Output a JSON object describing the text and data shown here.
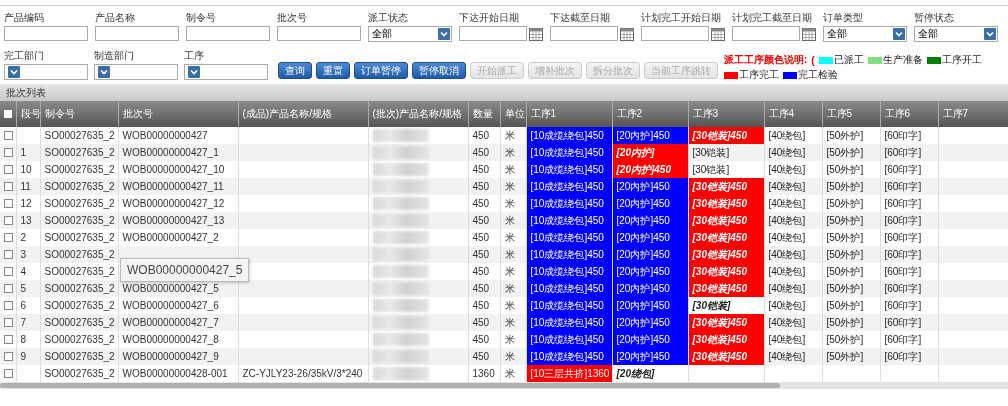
{
  "filters": [
    {
      "label": "产品编码",
      "kind": "text"
    },
    {
      "label": "产品名称",
      "kind": "text"
    },
    {
      "label": "制令号",
      "kind": "text"
    },
    {
      "label": "批次号",
      "kind": "text"
    },
    {
      "label": "派工状态",
      "kind": "select",
      "value": "全部"
    },
    {
      "label": "下达开始日期",
      "kind": "date"
    },
    {
      "label": "下达截至日期",
      "kind": "date"
    },
    {
      "label": "计划完工开始日期",
      "kind": "date"
    },
    {
      "label": "计划完工截至日期",
      "kind": "date"
    },
    {
      "label": "订单类型",
      "kind": "select",
      "value": "全部"
    },
    {
      "label": "暂停状态",
      "kind": "select",
      "value": "全部"
    }
  ],
  "filters2": [
    {
      "label": "完工部门",
      "kind": "select"
    },
    {
      "label": "制造部门",
      "kind": "select"
    },
    {
      "label": "工序",
      "kind": "select"
    }
  ],
  "buttons": [
    {
      "label": "查询",
      "disabled": false
    },
    {
      "label": "重置",
      "disabled": false
    },
    {
      "label": "订单暂停",
      "disabled": false
    },
    {
      "label": "暂停取消",
      "disabled": false
    },
    {
      "label": "开始派工",
      "disabled": true
    },
    {
      "label": "增补批次",
      "disabled": true
    },
    {
      "label": "拆分批次",
      "disabled": true
    },
    {
      "label": "当前工序跳转",
      "disabled": true
    }
  ],
  "legend": {
    "title": "派工工序颜色说明:",
    "open": "(",
    "items": [
      {
        "label": "已派工",
        "color": "#00ffff"
      },
      {
        "label": "生产准备",
        "color": "#80e080"
      },
      {
        "label": "工序开工",
        "color": "#008000"
      },
      {
        "label": "工序完工",
        "color": "#ff0000"
      },
      {
        "label": "完工检验",
        "color": "#0000ff"
      }
    ]
  },
  "panel_title": "批次列表",
  "table": {
    "select_all_checked": false,
    "columns": [
      "段号",
      "制令号",
      "批次号",
      "(成品)产品名称/规格",
      "(批次)产品名称/规格",
      "数量",
      "单位",
      "工序1",
      "工序2",
      "工序3",
      "工序4",
      "工序5",
      "工序6",
      "工序7"
    ],
    "rows": [
      {
        "checked": false,
        "seq": "",
        "order": "SO00027635_2",
        "batch": "WOB00000000427",
        "qty": "450",
        "unit": "米",
        "procs": [
          {
            "text": "[10成缆绕包]450",
            "color": "#0000ff",
            "in_progress": false
          },
          {
            "text": "[20内护]450",
            "color": "#0000ff",
            "in_progress": false
          },
          {
            "text": "[30铠装]450",
            "color": "#ff0000",
            "in_progress": true
          },
          {
            "text": "[40绕包]",
            "in_progress": false
          },
          {
            "text": "[50外护]",
            "in_progress": false
          },
          {
            "text": "[60印字]",
            "in_progress": false
          }
        ]
      },
      {
        "checked": false,
        "seq": "1",
        "order": "SO00027635_2",
        "batch": "WOB00000000427_1",
        "qty": "450",
        "unit": "米",
        "procs": [
          {
            "text": "[10成缆绕包]450",
            "color": "#0000ff",
            "in_progress": false
          },
          {
            "text": "[20内护]",
            "color": "#ff0000",
            "in_progress": true
          },
          {
            "text": "[30铠装]",
            "in_progress": false
          },
          {
            "text": "[40绕包]",
            "in_progress": false
          },
          {
            "text": "[50外护]",
            "in_progress": false
          },
          {
            "text": "[60印字]",
            "in_progress": false
          }
        ]
      },
      {
        "checked": false,
        "seq": "10",
        "order": "SO00027635_2",
        "batch": "WOB00000000427_10",
        "qty": "450",
        "unit": "米",
        "procs": [
          {
            "text": "[10成缆绕包]450",
            "color": "#0000ff",
            "in_progress": false
          },
          {
            "text": "[20内护]450",
            "color": "#ff0000",
            "in_progress": true
          },
          {
            "text": "[30铠装]",
            "in_progress": false
          },
          {
            "text": "[40绕包]",
            "in_progress": false
          },
          {
            "text": "[50外护]",
            "in_progress": false
          },
          {
            "text": "[60印字]",
            "in_progress": false
          }
        ]
      },
      {
        "checked": false,
        "seq": "11",
        "order": "SO00027635_2",
        "batch": "WOB00000000427_11",
        "qty": "450",
        "unit": "米",
        "procs": [
          {
            "text": "[10成缆绕包]450",
            "color": "#0000ff",
            "in_progress": false
          },
          {
            "text": "[20内护]450",
            "color": "#0000ff",
            "in_progress": false
          },
          {
            "text": "[30铠装]450",
            "color": "#ff0000",
            "in_progress": true
          },
          {
            "text": "[40绕包]",
            "in_progress": false
          },
          {
            "text": "[50外护]",
            "in_progress": false
          },
          {
            "text": "[60印字]",
            "in_progress": false
          }
        ]
      },
      {
        "checked": false,
        "seq": "12",
        "order": "SO00027635_2",
        "batch": "WOB00000000427_12",
        "qty": "450",
        "unit": "米",
        "procs": [
          {
            "text": "[10成缆绕包]450",
            "color": "#0000ff",
            "in_progress": false
          },
          {
            "text": "[20内护]450",
            "color": "#0000ff",
            "in_progress": false
          },
          {
            "text": "[30铠装]450",
            "color": "#ff0000",
            "in_progress": true
          },
          {
            "text": "[40绕包]",
            "in_progress": false
          },
          {
            "text": "[50外护]",
            "in_progress": false
          },
          {
            "text": "[60印字]",
            "in_progress": false
          }
        ]
      },
      {
        "checked": false,
        "seq": "13",
        "order": "SO00027635_2",
        "batch": "WOB00000000427_13",
        "qty": "450",
        "unit": "米",
        "procs": [
          {
            "text": "[10成缆绕包]450",
            "color": "#0000ff",
            "in_progress": false
          },
          {
            "text": "[20内护]450",
            "color": "#0000ff",
            "in_progress": false
          },
          {
            "text": "[30铠装]450",
            "color": "#ff0000",
            "in_progress": true
          },
          {
            "text": "[40绕包]",
            "in_progress": false
          },
          {
            "text": "[50外护]",
            "in_progress": false
          },
          {
            "text": "[60印字]",
            "in_progress": false
          }
        ]
      },
      {
        "checked": false,
        "seq": "2",
        "order": "SO00027635_2",
        "batch": "WOB00000000427_2",
        "qty": "450",
        "unit": "米",
        "procs": [
          {
            "text": "[10成缆绕包]450",
            "color": "#0000ff",
            "in_progress": false
          },
          {
            "text": "[20内护]450",
            "color": "#0000ff",
            "in_progress": false
          },
          {
            "text": "[30铠装]450",
            "color": "#ff0000",
            "in_progress": true
          },
          {
            "text": "[40绕包]",
            "in_progress": false
          },
          {
            "text": "[50外护]",
            "in_progress": false
          },
          {
            "text": "[60印字]",
            "in_progress": false
          }
        ]
      },
      {
        "checked": false,
        "seq": "3",
        "order": "SO00027635_2",
        "qty": "450",
        "unit": "米",
        "procs": [
          {
            "text": "[10成缆绕包]450",
            "color": "#0000ff",
            "in_progress": false
          },
          {
            "text": "[20内护]450",
            "color": "#0000ff",
            "in_progress": false
          },
          {
            "text": "[30铠装]450",
            "color": "#ff0000",
            "in_progress": true
          },
          {
            "text": "[40绕包]",
            "in_progress": false
          },
          {
            "text": "[50外护]",
            "in_progress": false
          },
          {
            "text": "[60印字]",
            "in_progress": false
          }
        ]
      },
      {
        "checked": false,
        "seq": "4",
        "order": "SO00027635_2",
        "qty": "450",
        "unit": "米",
        "procs": [
          {
            "text": "[10成缆绕包]450",
            "color": "#0000ff",
            "in_progress": false
          },
          {
            "text": "[20内护]450",
            "color": "#0000ff",
            "in_progress": false
          },
          {
            "text": "[30铠装]450",
            "color": "#ff0000",
            "in_progress": true
          },
          {
            "text": "[40绕包]",
            "in_progress": false
          },
          {
            "text": "[50外护]",
            "in_progress": false
          },
          {
            "text": "[60印字]",
            "in_progress": false
          }
        ]
      },
      {
        "checked": false,
        "seq": "5",
        "order": "SO00027635_2",
        "batch": "WOB00000000427_5",
        "qty": "450",
        "unit": "米",
        "procs": [
          {
            "text": "[10成缆绕包]450",
            "color": "#0000ff",
            "in_progress": false
          },
          {
            "text": "[20内护]450",
            "color": "#0000ff",
            "in_progress": false
          },
          {
            "text": "[30铠装]450",
            "color": "#ff0000",
            "in_progress": true
          },
          {
            "text": "[40绕包]",
            "in_progress": false
          },
          {
            "text": "[50外护]",
            "in_progress": false
          },
          {
            "text": "[60印字]",
            "in_progress": false
          }
        ]
      },
      {
        "checked": false,
        "seq": "6",
        "order": "SO00027635_2",
        "batch": "WOB00000000427_6",
        "qty": "450",
        "unit": "米",
        "procs": [
          {
            "text": "[10成缆绕包]450",
            "color": "#0000ff",
            "in_progress": false
          },
          {
            "text": "[20内护]450",
            "color": "#0000ff",
            "in_progress": false
          },
          {
            "text": "[30铠装]",
            "in_progress": true
          },
          {
            "text": "[40绕包]",
            "in_progress": false
          },
          {
            "text": "[50外护]",
            "in_progress": false
          },
          {
            "text": "[60印字]",
            "in_progress": false
          }
        ]
      },
      {
        "checked": false,
        "seq": "7",
        "order": "SO00027635_2",
        "batch": "WOB00000000427_7",
        "qty": "450",
        "unit": "米",
        "procs": [
          {
            "text": "[10成缆绕包]450",
            "color": "#0000ff",
            "in_progress": false
          },
          {
            "text": "[20内护]450",
            "color": "#0000ff",
            "in_progress": false
          },
          {
            "text": "[30铠装]450",
            "color": "#ff0000",
            "in_progress": true
          },
          {
            "text": "[40绕包]",
            "in_progress": false
          },
          {
            "text": "[50外护]",
            "in_progress": false
          },
          {
            "text": "[60印字]",
            "in_progress": false
          }
        ]
      },
      {
        "checked": false,
        "seq": "8",
        "order": "SO00027635_2",
        "batch": "WOB00000000427_8",
        "qty": "450",
        "unit": "米",
        "procs": [
          {
            "text": "[10成缆绕包]450",
            "color": "#0000ff",
            "in_progress": false
          },
          {
            "text": "[20内护]450",
            "color": "#0000ff",
            "in_progress": false
          },
          {
            "text": "[30铠装]450",
            "color": "#ff0000",
            "in_progress": true
          },
          {
            "text": "[40绕包]",
            "in_progress": false
          },
          {
            "text": "[50外护]",
            "in_progress": false
          },
          {
            "text": "[60印字]",
            "in_progress": false
          }
        ]
      },
      {
        "checked": false,
        "seq": "9",
        "order": "SO00027635_2",
        "batch": "WOB00000000427_9",
        "qty": "450",
        "unit": "米",
        "procs": [
          {
            "text": "[10成缆绕包]450",
            "color": "#0000ff",
            "in_progress": false
          },
          {
            "text": "[20内护]450",
            "color": "#0000ff",
            "in_progress": false
          },
          {
            "text": "[30铠装]450",
            "color": "#ff0000",
            "in_progress": true
          },
          {
            "text": "[40绕包]",
            "in_progress": false
          },
          {
            "text": "[50外护]",
            "in_progress": false
          },
          {
            "text": "[60印字]",
            "in_progress": false
          }
        ]
      },
      {
        "checked": false,
        "seq": "",
        "order": "SO00027635_2",
        "batch": "WOB00000000428-001",
        "product": "ZC-YJLY23-26/35kV/3*240",
        "qty": "1360",
        "unit": "米",
        "procs": [
          {
            "text": "[10三层共挤]1360",
            "color": "#ff0000",
            "in_progress": false
          },
          {
            "text": "[20绕包]",
            "in_progress": true
          }
        ]
      }
    ]
  },
  "tooltip": "WOB00000000427_5"
}
